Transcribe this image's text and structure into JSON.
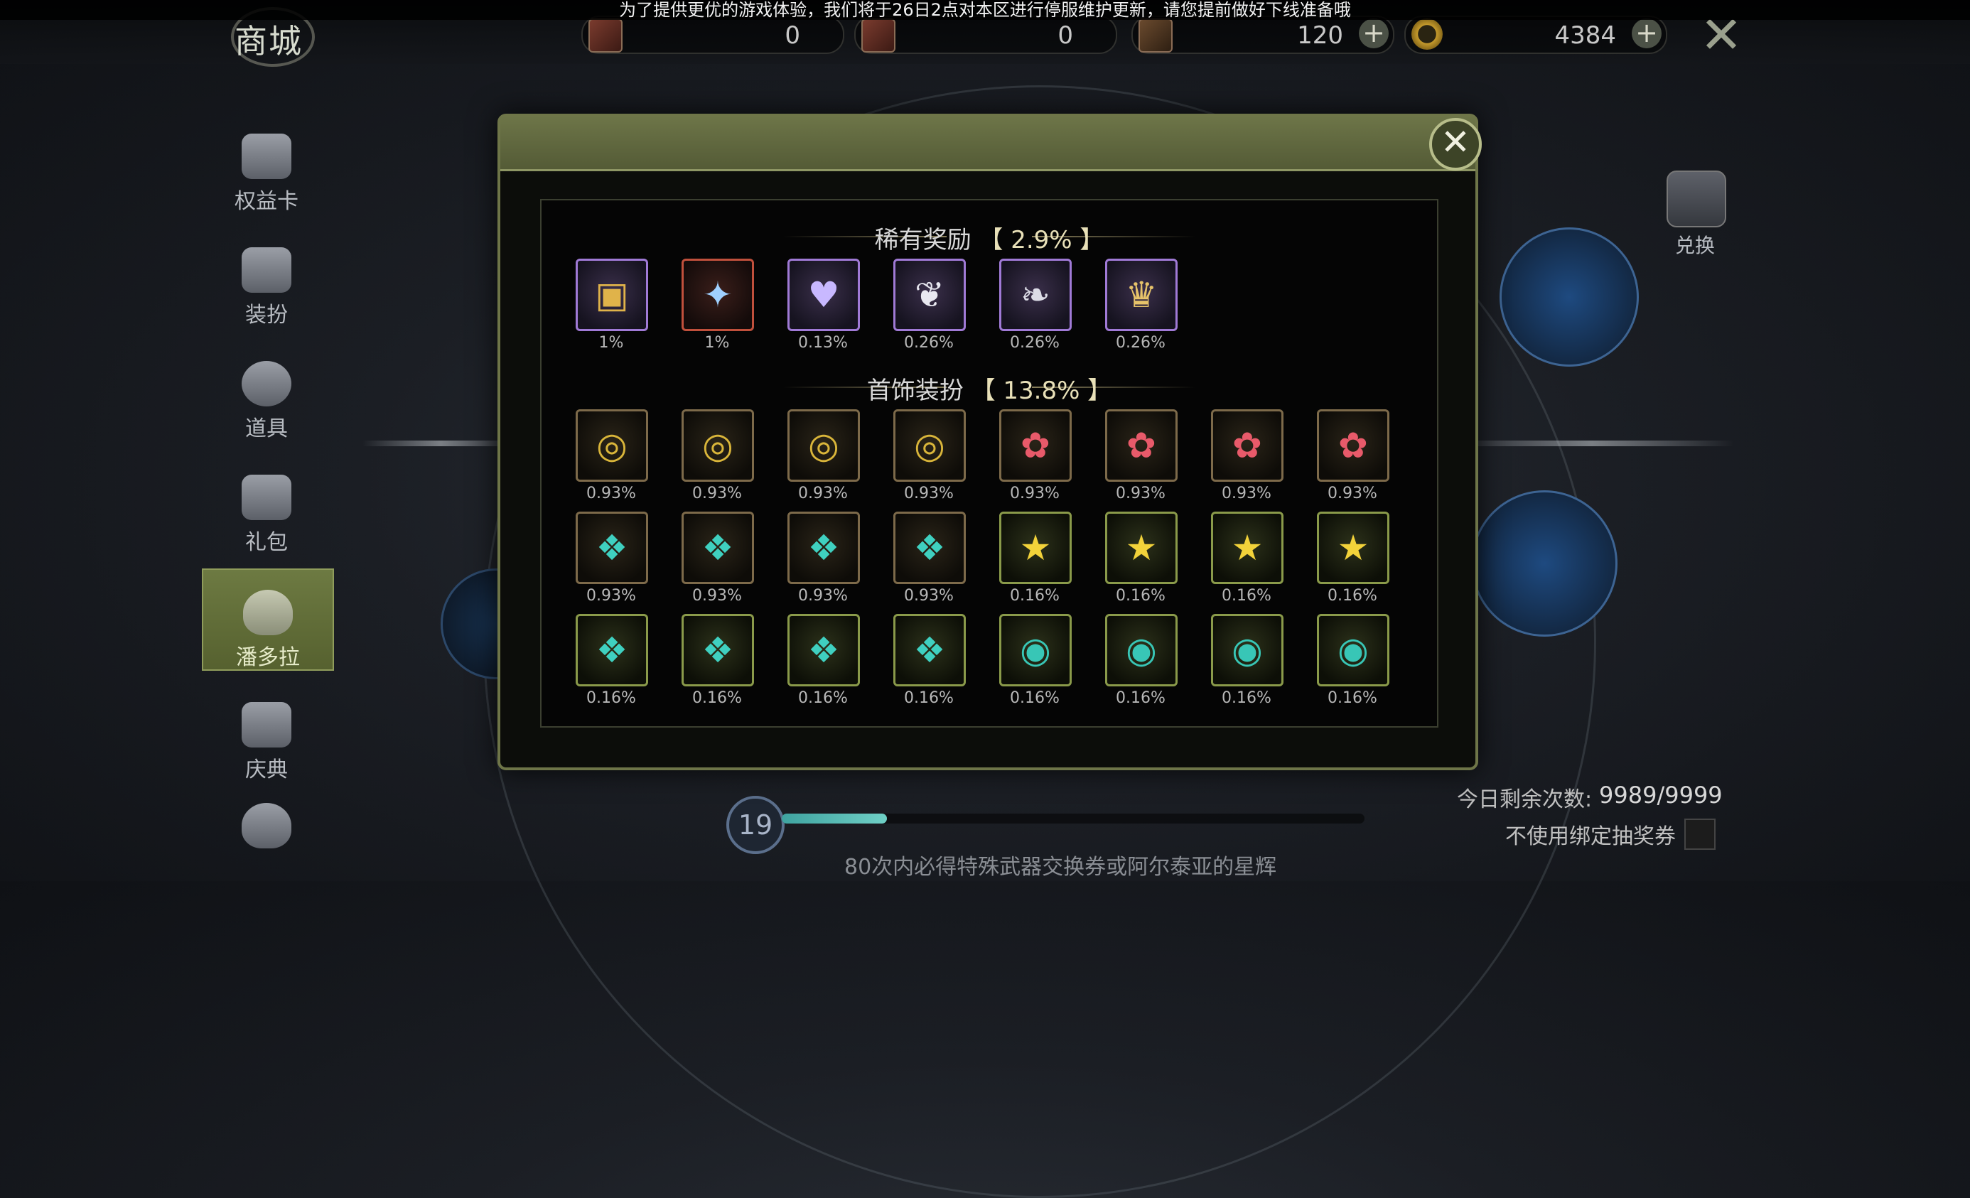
{
  "notice": "为了提供更优的游戏体验，我们将于26日2点对本区进行停服维护更新，请您提前做好下线准备哦",
  "header": {
    "title": "商城",
    "currencies": [
      {
        "icon": "red-card-icon",
        "value": "0"
      },
      {
        "icon": "red-card-plus-icon",
        "value": "0"
      },
      {
        "icon": "bronze-card-icon",
        "value": "120",
        "has_plus": true
      },
      {
        "icon": "coin-ring-icon",
        "value": "4384",
        "has_plus": true
      }
    ]
  },
  "sidebar": {
    "items": [
      {
        "label": "权益卡",
        "icon": "card-icon"
      },
      {
        "label": "装扮",
        "icon": "outfit-icon"
      },
      {
        "label": "道具",
        "icon": "potion-icon"
      },
      {
        "label": "礼包",
        "icon": "gift-icon"
      },
      {
        "label": "潘多拉",
        "icon": "pandora-heart-icon",
        "active": true
      },
      {
        "label": "庆典",
        "icon": "celebration-icon"
      },
      {
        "label": "",
        "icon": "money-bag-icon"
      }
    ]
  },
  "right_panel": {
    "exchange_label": "兑换",
    "remaining_label": "今日剩余次数:",
    "remaining_value": "9989/9999",
    "no_bind_label": "不使用绑定抽奖券",
    "counter": "19",
    "progress": 0.18,
    "guarantee_text": "80次内必得特殊武器交换券或阿尔泰亚的星辉"
  },
  "modal": {
    "rare_section": {
      "title": "稀有奖励",
      "percent": "【 2.9% 】",
      "items": [
        {
          "icon": "red-box-icon",
          "prob": "1%",
          "border": "purple"
        },
        {
          "icon": "blue-star-orb-icon",
          "prob": "1%",
          "border": "red"
        },
        {
          "icon": "heart-orb-icon",
          "prob": "0.13%",
          "border": "purple"
        },
        {
          "icon": "white-wing-icon",
          "prob": "0.26%",
          "border": "purple"
        },
        {
          "icon": "feather-tassel-icon",
          "prob": "0.26%",
          "border": "purple"
        },
        {
          "icon": "golden-crown-icon",
          "prob": "0.26%",
          "border": "purple"
        }
      ]
    },
    "accessory_section": {
      "title": "首饰装扮",
      "percent": "【 13.8% 】",
      "rows": [
        [
          {
            "icon": "gold-ring-icon",
            "prob": "0.93%",
            "border": "brown"
          },
          {
            "icon": "gold-ring-icon",
            "prob": "0.93%",
            "border": "brown"
          },
          {
            "icon": "gold-ring-icon",
            "prob": "0.93%",
            "border": "brown"
          },
          {
            "icon": "gold-ring-icon",
            "prob": "0.93%",
            "border": "brown"
          },
          {
            "icon": "red-flower-icon",
            "prob": "0.93%",
            "border": "brown"
          },
          {
            "icon": "red-flower-icon",
            "prob": "0.93%",
            "border": "brown"
          },
          {
            "icon": "red-flower-icon",
            "prob": "0.93%",
            "border": "brown"
          },
          {
            "icon": "red-flower-icon",
            "prob": "0.93%",
            "border": "brown"
          }
        ],
        [
          {
            "icon": "gem-charm-icon",
            "prob": "0.93%",
            "border": "brown"
          },
          {
            "icon": "gem-charm-icon",
            "prob": "0.93%",
            "border": "brown"
          },
          {
            "icon": "gem-charm-icon",
            "prob": "0.93%",
            "border": "brown"
          },
          {
            "icon": "gem-charm-icon",
            "prob": "0.93%",
            "border": "brown"
          },
          {
            "icon": "star-earrings-icon",
            "prob": "0.16%",
            "border": "green"
          },
          {
            "icon": "star-earrings-icon",
            "prob": "0.16%",
            "border": "green"
          },
          {
            "icon": "star-earrings-icon",
            "prob": "0.16%",
            "border": "green"
          },
          {
            "icon": "star-earrings-icon",
            "prob": "0.16%",
            "border": "green"
          }
        ],
        [
          {
            "icon": "gem-charm-icon",
            "prob": "0.16%",
            "border": "green"
          },
          {
            "icon": "gem-charm-icon",
            "prob": "0.16%",
            "border": "green"
          },
          {
            "icon": "gem-charm-icon",
            "prob": "0.16%",
            "border": "green"
          },
          {
            "icon": "gem-charm-icon",
            "prob": "0.16%",
            "border": "green"
          },
          {
            "icon": "gem-ring-icon",
            "prob": "0.16%",
            "border": "green"
          },
          {
            "icon": "gem-ring-icon",
            "prob": "0.16%",
            "border": "green"
          },
          {
            "icon": "gem-ring-icon",
            "prob": "0.16%",
            "border": "green"
          },
          {
            "icon": "gem-ring-icon",
            "prob": "0.16%",
            "border": "green"
          }
        ]
      ]
    }
  },
  "colors": {
    "accent_olive": "#6d7548",
    "rare_border": "#a07ad6",
    "epic_border": "#8a9a4a"
  }
}
